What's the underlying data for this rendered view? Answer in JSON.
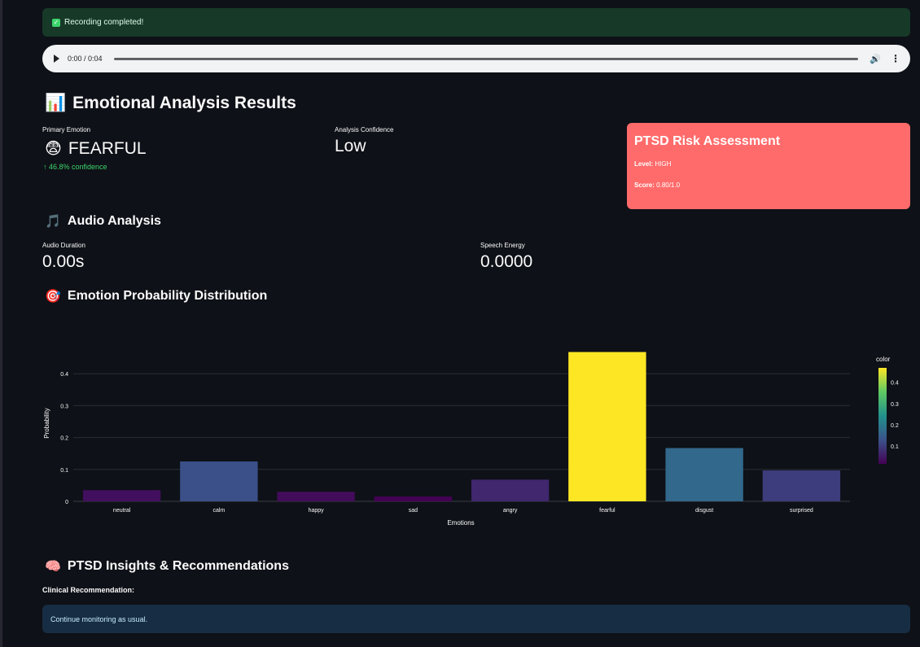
{
  "alert": {
    "text": "Recording completed!"
  },
  "audio_player": {
    "time": "0:00 / 0:04",
    "progress": 0.0
  },
  "results": {
    "title": "Emotional Analysis Results",
    "primary_emotion": {
      "label": "Primary Emotion",
      "value": "FEARFUL",
      "delta": "46.8% confidence"
    },
    "confidence": {
      "label": "Analysis Confidence",
      "value": "Low"
    }
  },
  "risk": {
    "title": "PTSD Risk Assessment",
    "level_label": "Level:",
    "level_value": "HIGH",
    "score_label": "Score:",
    "score_value": "0.80/1.0",
    "color": "#ff6b6b"
  },
  "audio_analysis": {
    "title": "Audio Analysis",
    "duration": {
      "label": "Audio Duration",
      "value": "0.00s"
    },
    "energy": {
      "label": "Speech Energy",
      "value": "0.0000"
    }
  },
  "distribution": {
    "title": "Emotion Probability Distribution"
  },
  "chart_data": {
    "type": "bar",
    "categories": [
      "neutral",
      "calm",
      "happy",
      "sad",
      "angry",
      "fearful",
      "disgust",
      "surprised"
    ],
    "values": [
      0.035,
      0.125,
      0.03,
      0.015,
      0.068,
      0.468,
      0.167,
      0.097
    ],
    "xlabel": "Emotions",
    "ylabel": "Probability",
    "ylim": [
      0,
      0.5
    ],
    "yticks": [
      0,
      0.1,
      0.2,
      0.3,
      0.4
    ],
    "ytick_labels": [
      "0",
      "0.1",
      "0.2",
      "0.3",
      "0.4"
    ],
    "colorbar": {
      "title": "color",
      "ticks": [
        "0.1",
        "0.2",
        "0.3",
        "0.4"
      ],
      "colorscale": "viridis"
    },
    "grid": true
  },
  "insights": {
    "title": "PTSD Insights & Recommendations",
    "rec_label": "Clinical Recommendation:",
    "rec_text": "Continue monitoring as usual."
  }
}
